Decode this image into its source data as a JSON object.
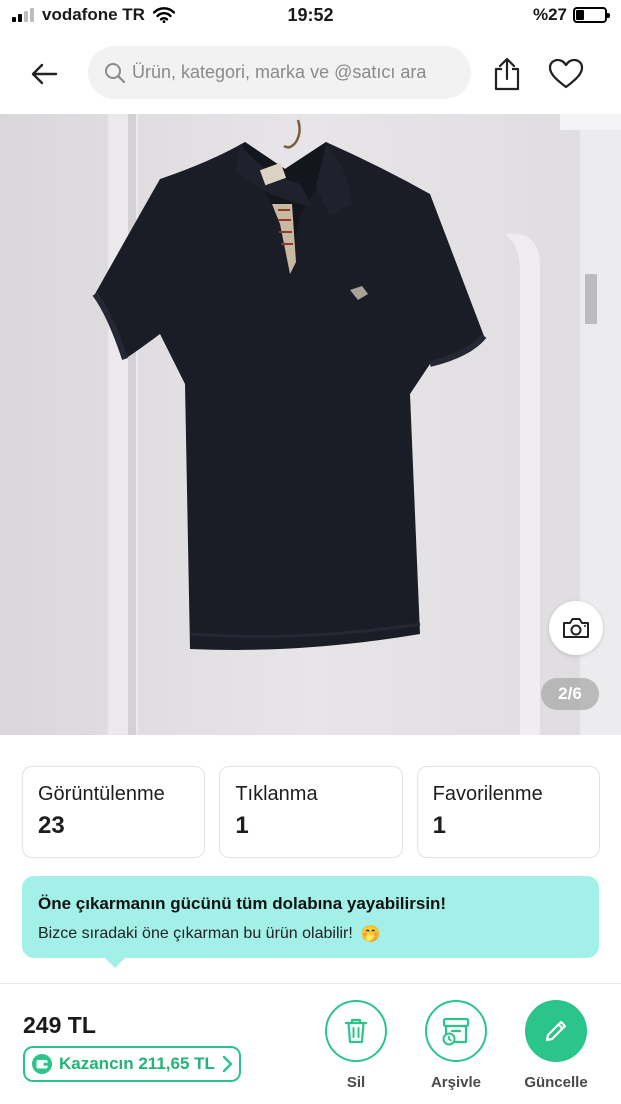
{
  "status_bar": {
    "carrier": "vodafone TR",
    "time": "19:52",
    "battery_percent": "%27",
    "battery_level": 0.27
  },
  "header": {
    "back_icon": "arrow-left-icon",
    "search_placeholder": "Ürün, kategori, marka ve @satıcı ara",
    "share_icon": "share-icon",
    "favorite_icon": "heart-icon"
  },
  "gallery": {
    "image_subject": "black polo shirt on hanger",
    "camera_icon": "camera-icon",
    "counter": "2/6"
  },
  "stats": [
    {
      "label": "Görüntülenme",
      "value": "23"
    },
    {
      "label": "Tıklanma",
      "value": "1"
    },
    {
      "label": "Favorilenme",
      "value": "1"
    }
  ],
  "promo": {
    "title": "Öne çıkarmanın gücünü tüm dolabına yayabilirsin!",
    "subtitle": "Bizce sıradaki öne çıkarman bu ürün olabilir!",
    "emoji": "🤭",
    "background": "#a3f0e8"
  },
  "bottom_bar": {
    "price": "249 TL",
    "earnings": "Kazancın 211,65 TL",
    "accent": "#2bc48a",
    "actions": [
      {
        "label": "Sil",
        "icon": "trash-icon"
      },
      {
        "label": "Arşivle",
        "icon": "archive-icon"
      },
      {
        "label": "Güncelle",
        "icon": "pencil-icon"
      }
    ]
  }
}
